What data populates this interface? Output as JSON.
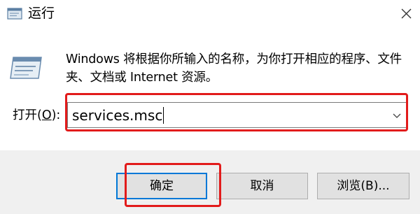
{
  "window": {
    "title": "运行",
    "icon": "run-icon"
  },
  "description": "Windows 将根据你所输入的名称，为你打开相应的程序、文件夹、文档或 Internet 资源。",
  "open": {
    "label_prefix": "打开(",
    "label_mnemonic": "O",
    "label_suffix": "):",
    "value": "services.msc"
  },
  "buttons": {
    "ok": "确定",
    "cancel": "取消",
    "browse": "浏览(B)..."
  },
  "colors": {
    "highlight": "#e21b1b",
    "focus_border": "#0078d7",
    "footer_bg": "#f0f0f0"
  }
}
